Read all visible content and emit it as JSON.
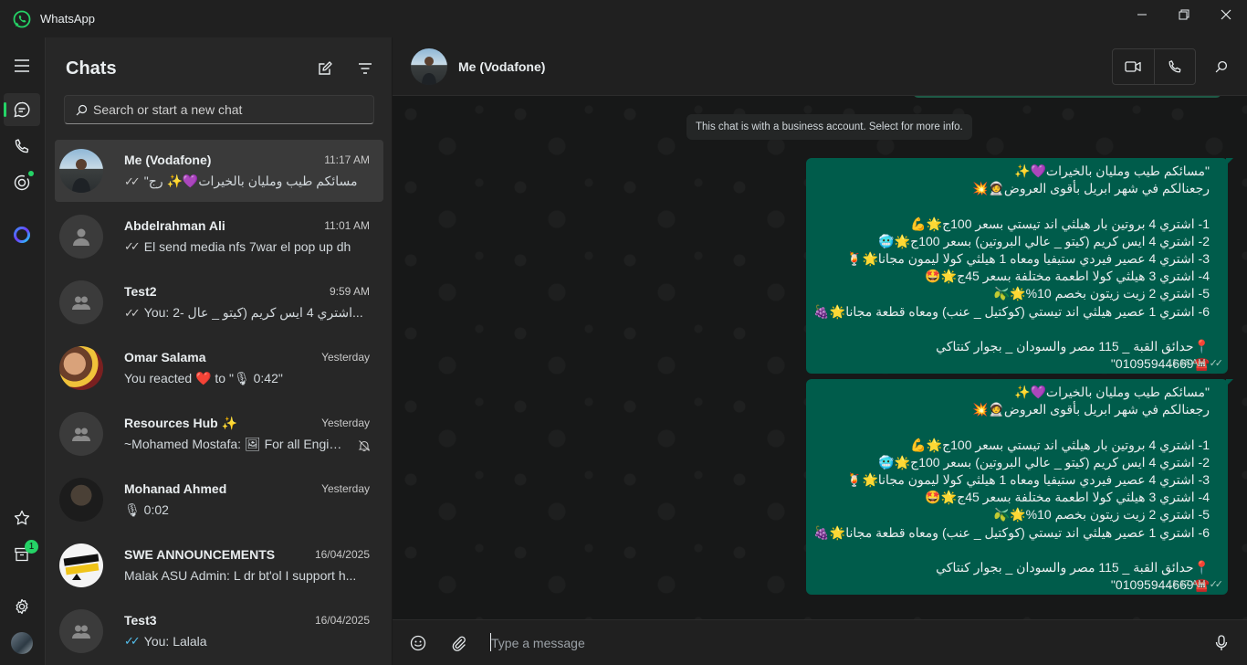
{
  "window": {
    "title": "WhatsApp",
    "colors": {
      "accent": "#25d366",
      "outgoing_bubble": "#005c4b",
      "background": "#202020"
    }
  },
  "rail": {
    "items": [
      "menu-icon",
      "chats-icon",
      "calls-icon",
      "status-icon",
      "meta-ai-icon",
      "starred-icon",
      "archived-icon",
      "settings-icon",
      "profile-avatar"
    ],
    "archived_badge": "1"
  },
  "chatlist": {
    "title": "Chats",
    "search_placeholder": "Search or start a new chat",
    "chats": [
      {
        "name": "Me (Vodafone)",
        "time": "11:17 AM",
        "preview": "\"مسائكم طيب ومليان بالخيرات💜✨ رج",
        "tick": "read-grey",
        "selected": true
      },
      {
        "name": "Abdelrahman Ali",
        "time": "11:01 AM",
        "preview": "El send media nfs 7war el pop up dh",
        "tick": "read-grey"
      },
      {
        "name": "Test2",
        "time": "9:59 AM",
        "preview": "You: 2- اشتري 4 ايس كريم (كيتو _ عال...",
        "tick": "read-grey"
      },
      {
        "name": "Omar Salama",
        "time": "Yesterday",
        "preview": "You reacted ❤️ to \"🎙 0:42\""
      },
      {
        "name": "Resources Hub ✨",
        "time": "Yesterday",
        "preview": "~Mohamed Mostafa: 🖼 For all Engineers",
        "muted": true
      },
      {
        "name": "Mohanad Ahmed",
        "time": "Yesterday",
        "preview": "🎙 0:02"
      },
      {
        "name": "SWE ANNOUNCEMENTS",
        "time": "16/04/2025",
        "preview": "Malak ASU Admin: L dr bt'ol I support h..."
      },
      {
        "name": "Test3",
        "time": "16/04/2025",
        "preview": "You: Lalala",
        "tick": "read-blue"
      }
    ]
  },
  "conversation": {
    "name": "Me (Vodafone)",
    "system_note": "This chat is with a business account. Select for more info.",
    "messages": [
      {
        "text": "\"مسائكم طيب ومليان بالخيرات💜✨\nرجعنالكم في شهر ابريل بأقوى العروض🧑‍🚀💥\n\n1- اشتري 4 بروتين بار هيلثي اند تيستي بسعر 100ج🌟💪\n2- اشتري 4 ايس كريم (كيتو _ عالي البروتين) بسعر 100ج🌟🥶\n3- اشتري 4 عصير فيردي ستيفيا ومعاه 1 هيلثي كولا ليمون مجانا🌟🍹\n4- اشتري 3 هيلثي كولا اطعمة مختلفة بسعر 45ج🌟🤩\n5- اشتري 2 زيت زيتون بخصم 10%🌟🫒\n6- اشتري 1 عصير هيلثي اند تيستي (كوكتيل _ عنب) ومعاه قطعة مجانا🌟🍇\n\n📍حدائق القبة _ 115 مصر والسودان _ بجوار كنتاكي\n☎️01095944669\"",
        "time": "11:16 AM"
      },
      {
        "text": "\"مسائكم طيب ومليان بالخيرات💜✨\nرجعنالكم في شهر ابريل بأقوى العروض🧑‍🚀💥\n\n1- اشتري 4 بروتين بار هيلثي اند تيستي بسعر 100ج🌟💪\n2- اشتري 4 ايس كريم (كيتو _ عالي البروتين) بسعر 100ج🌟🥶\n3- اشتري 4 عصير فيردي ستيفيا ومعاه 1 هيلثي كولا ليمون مجانا🌟🍹\n4- اشتري 3 هيلثي كولا اطعمة مختلفة بسعر 45ج🌟🤩\n5- اشتري 2 زيت زيتون بخصم 10%🌟🫒\n6- اشتري 1 عصير هيلثي اند تيستي (كوكتيل _ عنب) ومعاه قطعة مجانا🌟🍇\n\n📍حدائق القبة _ 115 مصر والسودان _ بجوار كنتاكي\n☎️01095944669\"",
        "time": "11:17 AM"
      }
    ],
    "composer_placeholder": "Type a message"
  }
}
